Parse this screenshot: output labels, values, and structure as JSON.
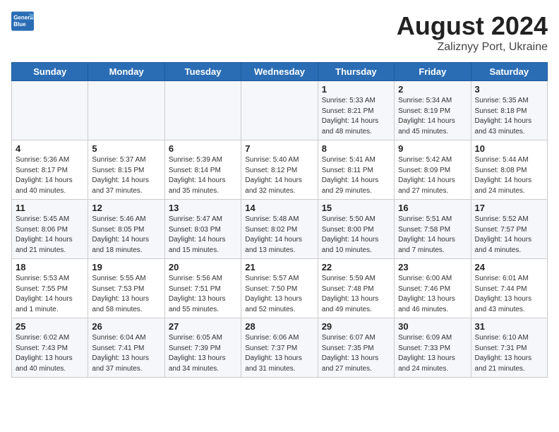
{
  "header": {
    "logo_line1": "General",
    "logo_line2": "Blue",
    "title": "August 2024",
    "subtitle": "Zaliznyy Port, Ukraine"
  },
  "days_of_week": [
    "Sunday",
    "Monday",
    "Tuesday",
    "Wednesday",
    "Thursday",
    "Friday",
    "Saturday"
  ],
  "weeks": [
    [
      {
        "day": "",
        "info": ""
      },
      {
        "day": "",
        "info": ""
      },
      {
        "day": "",
        "info": ""
      },
      {
        "day": "",
        "info": ""
      },
      {
        "day": "1",
        "info": "Sunrise: 5:33 AM\nSunset: 8:21 PM\nDaylight: 14 hours\nand 48 minutes."
      },
      {
        "day": "2",
        "info": "Sunrise: 5:34 AM\nSunset: 8:19 PM\nDaylight: 14 hours\nand 45 minutes."
      },
      {
        "day": "3",
        "info": "Sunrise: 5:35 AM\nSunset: 8:18 PM\nDaylight: 14 hours\nand 43 minutes."
      }
    ],
    [
      {
        "day": "4",
        "info": "Sunrise: 5:36 AM\nSunset: 8:17 PM\nDaylight: 14 hours\nand 40 minutes."
      },
      {
        "day": "5",
        "info": "Sunrise: 5:37 AM\nSunset: 8:15 PM\nDaylight: 14 hours\nand 37 minutes."
      },
      {
        "day": "6",
        "info": "Sunrise: 5:39 AM\nSunset: 8:14 PM\nDaylight: 14 hours\nand 35 minutes."
      },
      {
        "day": "7",
        "info": "Sunrise: 5:40 AM\nSunset: 8:12 PM\nDaylight: 14 hours\nand 32 minutes."
      },
      {
        "day": "8",
        "info": "Sunrise: 5:41 AM\nSunset: 8:11 PM\nDaylight: 14 hours\nand 29 minutes."
      },
      {
        "day": "9",
        "info": "Sunrise: 5:42 AM\nSunset: 8:09 PM\nDaylight: 14 hours\nand 27 minutes."
      },
      {
        "day": "10",
        "info": "Sunrise: 5:44 AM\nSunset: 8:08 PM\nDaylight: 14 hours\nand 24 minutes."
      }
    ],
    [
      {
        "day": "11",
        "info": "Sunrise: 5:45 AM\nSunset: 8:06 PM\nDaylight: 14 hours\nand 21 minutes."
      },
      {
        "day": "12",
        "info": "Sunrise: 5:46 AM\nSunset: 8:05 PM\nDaylight: 14 hours\nand 18 minutes."
      },
      {
        "day": "13",
        "info": "Sunrise: 5:47 AM\nSunset: 8:03 PM\nDaylight: 14 hours\nand 15 minutes."
      },
      {
        "day": "14",
        "info": "Sunrise: 5:48 AM\nSunset: 8:02 PM\nDaylight: 14 hours\nand 13 minutes."
      },
      {
        "day": "15",
        "info": "Sunrise: 5:50 AM\nSunset: 8:00 PM\nDaylight: 14 hours\nand 10 minutes."
      },
      {
        "day": "16",
        "info": "Sunrise: 5:51 AM\nSunset: 7:58 PM\nDaylight: 14 hours\nand 7 minutes."
      },
      {
        "day": "17",
        "info": "Sunrise: 5:52 AM\nSunset: 7:57 PM\nDaylight: 14 hours\nand 4 minutes."
      }
    ],
    [
      {
        "day": "18",
        "info": "Sunrise: 5:53 AM\nSunset: 7:55 PM\nDaylight: 14 hours\nand 1 minute."
      },
      {
        "day": "19",
        "info": "Sunrise: 5:55 AM\nSunset: 7:53 PM\nDaylight: 13 hours\nand 58 minutes."
      },
      {
        "day": "20",
        "info": "Sunrise: 5:56 AM\nSunset: 7:51 PM\nDaylight: 13 hours\nand 55 minutes."
      },
      {
        "day": "21",
        "info": "Sunrise: 5:57 AM\nSunset: 7:50 PM\nDaylight: 13 hours\nand 52 minutes."
      },
      {
        "day": "22",
        "info": "Sunrise: 5:59 AM\nSunset: 7:48 PM\nDaylight: 13 hours\nand 49 minutes."
      },
      {
        "day": "23",
        "info": "Sunrise: 6:00 AM\nSunset: 7:46 PM\nDaylight: 13 hours\nand 46 minutes."
      },
      {
        "day": "24",
        "info": "Sunrise: 6:01 AM\nSunset: 7:44 PM\nDaylight: 13 hours\nand 43 minutes."
      }
    ],
    [
      {
        "day": "25",
        "info": "Sunrise: 6:02 AM\nSunset: 7:43 PM\nDaylight: 13 hours\nand 40 minutes."
      },
      {
        "day": "26",
        "info": "Sunrise: 6:04 AM\nSunset: 7:41 PM\nDaylight: 13 hours\nand 37 minutes."
      },
      {
        "day": "27",
        "info": "Sunrise: 6:05 AM\nSunset: 7:39 PM\nDaylight: 13 hours\nand 34 minutes."
      },
      {
        "day": "28",
        "info": "Sunrise: 6:06 AM\nSunset: 7:37 PM\nDaylight: 13 hours\nand 31 minutes."
      },
      {
        "day": "29",
        "info": "Sunrise: 6:07 AM\nSunset: 7:35 PM\nDaylight: 13 hours\nand 27 minutes."
      },
      {
        "day": "30",
        "info": "Sunrise: 6:09 AM\nSunset: 7:33 PM\nDaylight: 13 hours\nand 24 minutes."
      },
      {
        "day": "31",
        "info": "Sunrise: 6:10 AM\nSunset: 7:31 PM\nDaylight: 13 hours\nand 21 minutes."
      }
    ]
  ]
}
